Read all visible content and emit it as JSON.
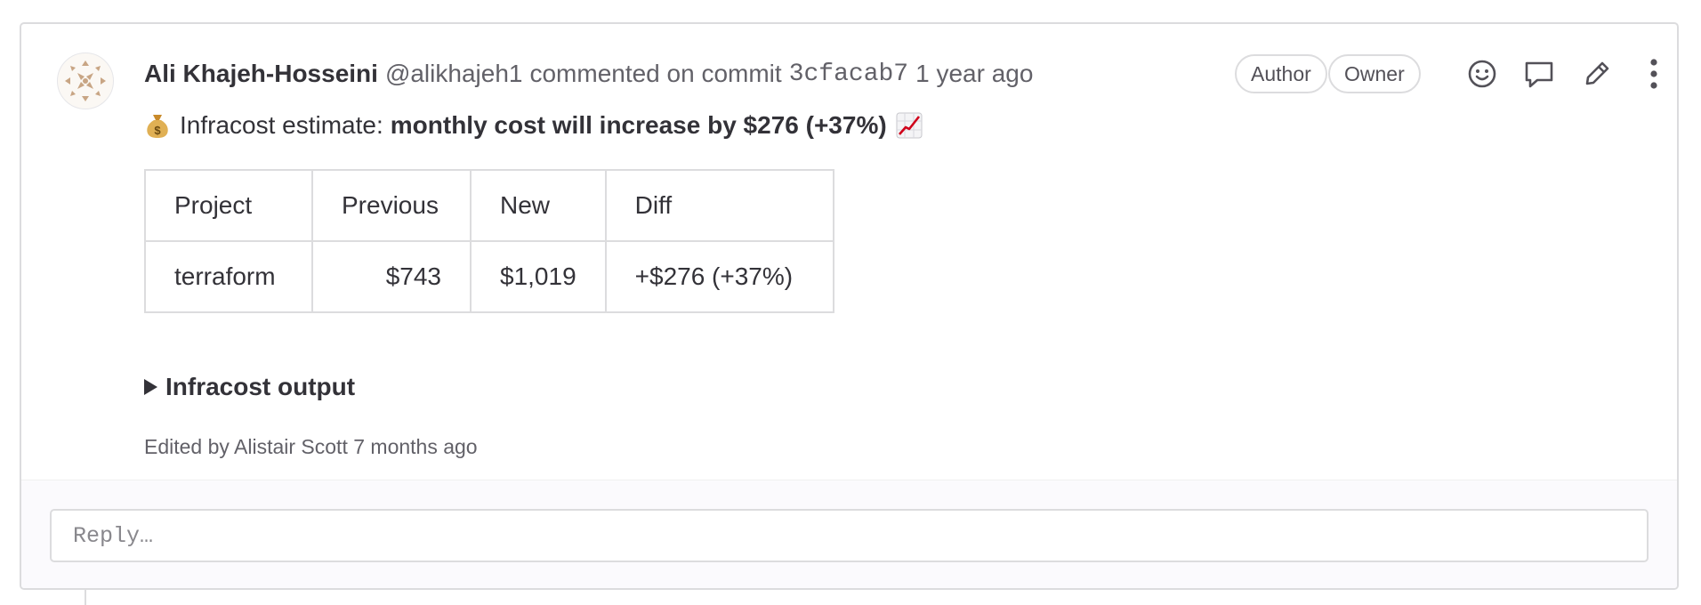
{
  "note": {
    "author_name": "Ali Khajeh-Hosseini",
    "author_handle": "@alikhajeh1",
    "action_text": "commented on commit",
    "commit_sha": "3cfacab7",
    "timestamp": "1 year ago",
    "badges": {
      "author": "Author",
      "owner": "Owner"
    },
    "actions": {
      "emoji_icon": "smiley-icon",
      "reply_icon": "comment-icon",
      "edit_icon": "pencil-icon",
      "more_icon": "kebab-vertical-icon"
    }
  },
  "body": {
    "estimate_prefix_icon": "money-bag-emoji",
    "estimate_prefix": "Infracost estimate:",
    "estimate_bold": "monthly cost will increase by $276 (+37%)",
    "estimate_suffix_icon": "chart-increasing-emoji",
    "table": {
      "headers": [
        "Project",
        "Previous",
        "New",
        "Diff"
      ],
      "rows": [
        [
          "terraform",
          "$743",
          "$1,019",
          "+$276 (+37%)"
        ]
      ]
    },
    "details_summary": "Infracost output",
    "edited_text": "Edited by Alistair Scott 7 months ago"
  },
  "reply": {
    "placeholder": "Reply…"
  },
  "colors": {
    "border": "#dcdcde",
    "text": "#333238",
    "muted": "#626168",
    "chart_red": "#d0021b",
    "money_bag": "#d9a441"
  }
}
